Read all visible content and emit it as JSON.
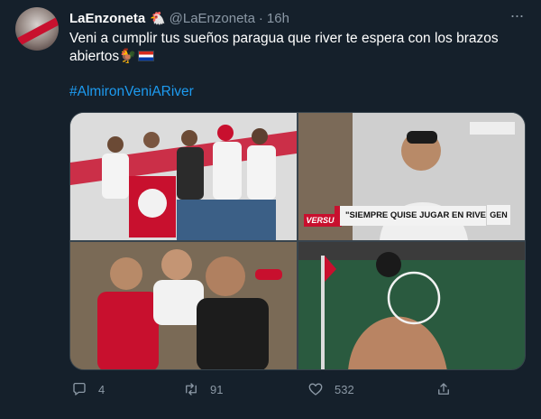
{
  "tweet": {
    "display_name": "LaEnzoneta",
    "name_emoji": "🐔",
    "handle": "@LaEnzoneta",
    "separator": "·",
    "time": "16h",
    "text": "Veni a cumplir tus sueños paragua que river te espera con los brazos abiertos🐓",
    "hashtag": "#AlmironVeniARiver"
  },
  "media": {
    "tv_logo": "VERSUS",
    "tv_banner": "\"SIEMPRE QUISE JUGAR EN RIVER\"",
    "tv_tag": "GEN"
  },
  "actions": {
    "reply_count": "4",
    "retweet_count": "91",
    "like_count": "532"
  },
  "colors": {
    "background": "#15202b",
    "text": "#ffffff",
    "muted": "#8b98a5",
    "link": "#1d9bf0",
    "river_red": "#c8102e"
  },
  "icons": [
    "more-icon",
    "reply-icon",
    "retweet-icon",
    "like-icon",
    "share-icon",
    "paraguay-flag-icon"
  ]
}
